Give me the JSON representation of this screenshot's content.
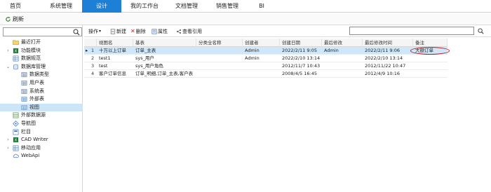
{
  "topnav": {
    "tabs": [
      {
        "label": "首页",
        "active": false
      },
      {
        "label": "系统管理",
        "active": false
      },
      {
        "label": "设计",
        "active": true
      },
      {
        "label": "我的工作台",
        "active": false
      },
      {
        "label": "文档管理",
        "active": false
      },
      {
        "label": "销售管理",
        "active": false
      },
      {
        "label": "BI",
        "active": false
      }
    ]
  },
  "refresh": {
    "label": "刷新"
  },
  "left": {
    "search": {
      "value": "",
      "placeholder": ""
    },
    "tree": [
      {
        "label": "最近打开",
        "icon": "folder-icon",
        "level": 1,
        "toggle": ""
      },
      {
        "label": "功能模块",
        "icon": "excel-icon",
        "level": 1,
        "toggle": "collapsed"
      },
      {
        "label": "数据规范",
        "icon": "grid-icon",
        "level": 1,
        "toggle": ""
      },
      {
        "label": "数据库管理",
        "icon": "database-icon",
        "level": 1,
        "toggle": "expanded"
      },
      {
        "label": "数据类型",
        "icon": "table-icon",
        "level": 2,
        "toggle": ""
      },
      {
        "label": "用户表",
        "icon": "table-icon",
        "level": 2,
        "toggle": ""
      },
      {
        "label": "系统表",
        "icon": "table-icon",
        "level": 2,
        "toggle": ""
      },
      {
        "label": "外部表",
        "icon": "table-icon",
        "level": 2,
        "toggle": ""
      },
      {
        "label": "视图",
        "icon": "table-icon",
        "level": 2,
        "toggle": "",
        "selected": true
      },
      {
        "label": "外部数据源",
        "icon": "datasource-icon",
        "level": 1,
        "toggle": ""
      },
      {
        "label": "导航图",
        "icon": "diamond-icon",
        "level": 1,
        "toggle": ""
      },
      {
        "label": "栏目",
        "icon": "column-icon",
        "level": 1,
        "toggle": ""
      },
      {
        "label": "CAD Writer",
        "icon": "excel-icon",
        "level": 1,
        "toggle": "collapsed"
      },
      {
        "label": "移动应用",
        "icon": "grid-icon",
        "level": 1,
        "toggle": "collapsed"
      },
      {
        "label": "WebApi",
        "icon": "cloud-icon",
        "level": 1,
        "toggle": ""
      }
    ]
  },
  "toolbar": {
    "operate": "操作",
    "new": "新建",
    "delete": "删除",
    "properties": "属性",
    "references": "查看引用",
    "search_value": ""
  },
  "grid": {
    "columns": [
      "视图名",
      "基表",
      "分类全名称",
      "创建者",
      "创建日期",
      "最后修改",
      "最后修改时间",
      "备注"
    ],
    "rows": [
      {
        "num": "1",
        "marker": "▸",
        "cells": [
          "十万以上订单",
          "订单_主表",
          "",
          "Admin",
          "2022/2/11 9:05",
          "Admin",
          "2022/2/11 9:06",
          "大额订单"
        ],
        "selected": true
      },
      {
        "num": "2",
        "marker": "",
        "cells": [
          "test1",
          "sys_用户",
          "",
          "Admin",
          "2022/2/10 13:14",
          "",
          "2022/2/10 13:14",
          ""
        ],
        "selected": false
      },
      {
        "num": "3",
        "marker": "",
        "cells": [
          "test",
          "sys_用户角色",
          "",
          "",
          "2012/11/7 10:43",
          "",
          "2012/11/22 10:47",
          ""
        ],
        "selected": false
      },
      {
        "num": "4",
        "marker": "",
        "cells": [
          "客户订单信息",
          "订单_明细,订单_主表,客户表",
          "",
          "",
          "2008/4/5 16:45",
          "",
          "2012/4/9 10:16",
          ""
        ],
        "selected": false
      }
    ]
  },
  "colors": {
    "accent": "#1e7fd6",
    "selected_row": "#cfe7f8",
    "annotation": "#c01818"
  }
}
